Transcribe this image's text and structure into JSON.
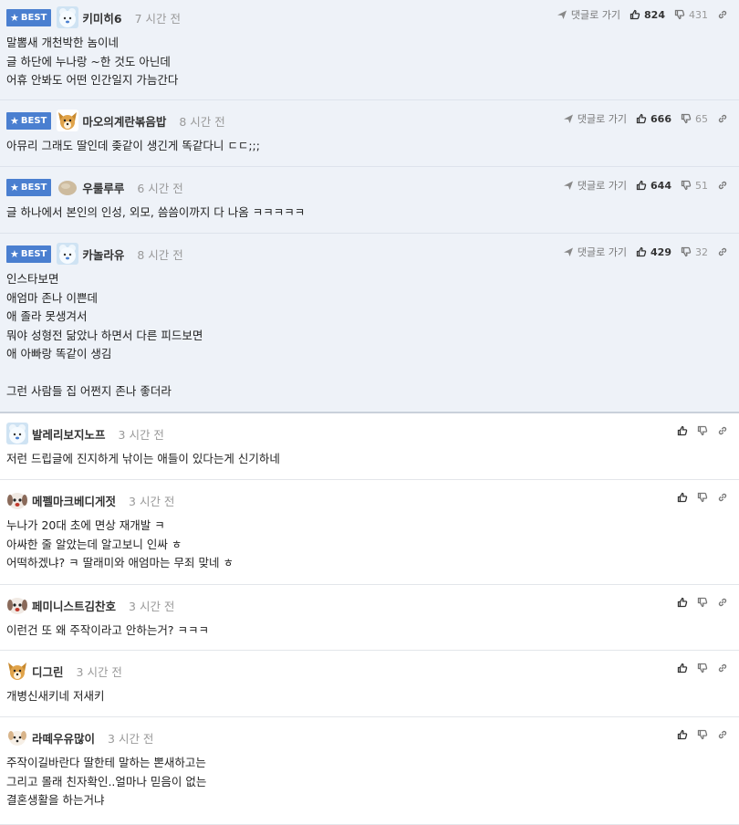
{
  "labels": {
    "best": "BEST",
    "reply": "댓글로 가기"
  },
  "best_comments": [
    {
      "nick": "키미히6",
      "time": "7 시간 전",
      "up": "824",
      "down": "431",
      "avatar": "bear",
      "lines": [
        "말뽐새 개천박한 놈이네",
        "글 하단에 누나랑 ~한 것도 아닌데",
        "어휴 안봐도 어떤 인간일지 가늠간다"
      ]
    },
    {
      "nick": "마오의계란볶음밥",
      "time": "8 시간 전",
      "up": "666",
      "down": "65",
      "avatar": "dog",
      "lines": [
        "아뮤리 그래도 딸인데 좆같이 생긴게 똑같다니 ㄷㄷ;;;"
      ]
    },
    {
      "nick": "우룰루루",
      "time": "6 시간 전",
      "up": "644",
      "down": "51",
      "avatar": "egg",
      "lines": [
        "글 하나에서 본인의 인성, 외모, 씀씀이까지 다 나옴 ㅋㅋㅋㅋㅋ"
      ]
    },
    {
      "nick": "카놀라유",
      "time": "8 시간 전",
      "up": "429",
      "down": "32",
      "avatar": "bear",
      "lines": [
        "인스타보면",
        "애엄마 존나 이쁜데",
        "애 졸라 못생겨서",
        "뭐야 성형전 닮았나 하면서 다른 피드보면",
        "애 아빠랑 똑같이 생김",
        "",
        "그런 사람들 집 어쩐지 존나 좋더라"
      ]
    }
  ],
  "comments": [
    {
      "nick": "발레리보지노프",
      "time": "3 시간 전",
      "avatar": "bear",
      "lines": [
        "저런 드립글에 진지하게 낚이는 애들이 있다는게 신기하네"
      ]
    },
    {
      "nick": "메펠마크베디게젓",
      "time": "3 시간 전",
      "avatar": "pup",
      "lines": [
        "누나가 20대 초에 면상 재개발 ㅋ",
        "아싸한 줄 알았는데 알고보니 인싸 ㅎ",
        "어떡하겠냐? ㅋ 딸래미와 애엄마는 무죄 맞네 ㅎ"
      ]
    },
    {
      "nick": "페미니스트김찬호",
      "time": "3 시간 전",
      "avatar": "pup",
      "lines": [
        "이런건 또 왜 주작이라고 안하는거? ㅋㅋㅋ"
      ]
    },
    {
      "nick": "디그린",
      "time": "3 시간 전",
      "avatar": "dog",
      "lines": [
        "개병신새키네 저새키"
      ]
    },
    {
      "nick": "라떼우유많이",
      "time": "3 시간 전",
      "avatar": "pup2",
      "lines": [
        "주작이길바란다 딸한테 말하는 뽄새하고는",
        "그리고 몰래 친자확인..얼마나 믿음이 없는",
        "결혼생활을 하는거냐"
      ]
    }
  ],
  "colors": {
    "best_badge": "#4a7fd0",
    "best_bg": "#eef2f8"
  }
}
